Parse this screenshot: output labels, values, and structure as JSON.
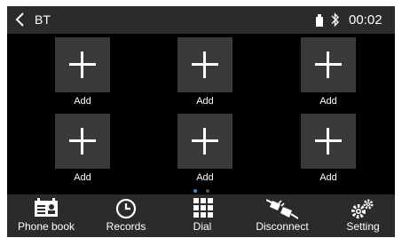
{
  "header": {
    "title": "BT",
    "time": "00:02"
  },
  "icons": {
    "back": "chevron-left-icon",
    "usb": "usb-icon",
    "bluetooth": "bluetooth-icon"
  },
  "favorites": [
    {
      "label": "Add",
      "icon": "plus-icon"
    },
    {
      "label": "Add",
      "icon": "plus-icon"
    },
    {
      "label": "Add",
      "icon": "plus-icon"
    },
    {
      "label": "Add",
      "icon": "plus-icon"
    },
    {
      "label": "Add",
      "icon": "plus-icon"
    },
    {
      "label": "Add",
      "icon": "plus-icon"
    }
  ],
  "pager": {
    "pages": 2,
    "current": 1
  },
  "nav": [
    {
      "label": "Phone book",
      "icon": "phonebook-icon"
    },
    {
      "label": "Records",
      "icon": "clock-icon"
    },
    {
      "label": "Dial",
      "icon": "dialpad-icon"
    },
    {
      "label": "Disconnect",
      "icon": "disconnect-icon"
    },
    {
      "label": "Setting",
      "icon": "gear-icon"
    }
  ],
  "colors": {
    "bar": "#2b2b2b",
    "tile": "#3a3a3a",
    "background": "#000000",
    "accent": "#2f8fd8"
  }
}
